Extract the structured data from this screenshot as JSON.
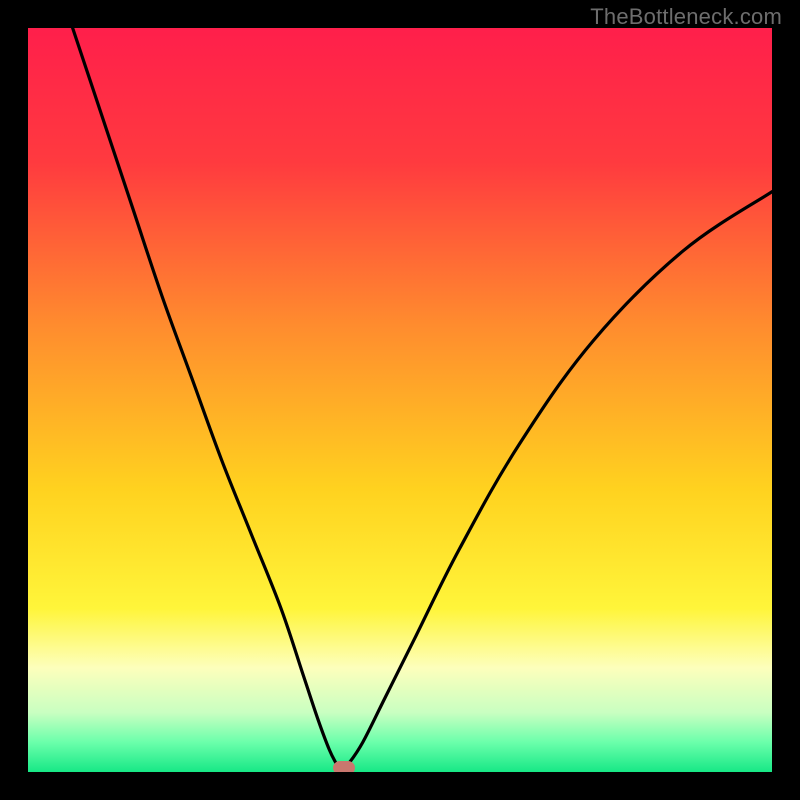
{
  "watermark": "TheBottleneck.com",
  "colors": {
    "frame": "#000000",
    "watermark_text": "#6d6d6d",
    "curve_stroke": "#000000",
    "marker": "#c9776e",
    "gradient_stops": [
      {
        "offset": "0%",
        "color": "#ff1f4b"
      },
      {
        "offset": "18%",
        "color": "#ff3a3f"
      },
      {
        "offset": "40%",
        "color": "#ff8c2e"
      },
      {
        "offset": "62%",
        "color": "#ffd21f"
      },
      {
        "offset": "78%",
        "color": "#fff53a"
      },
      {
        "offset": "86%",
        "color": "#fdffbc"
      },
      {
        "offset": "92%",
        "color": "#c9ffc1"
      },
      {
        "offset": "96%",
        "color": "#6bffab"
      },
      {
        "offset": "100%",
        "color": "#17e886"
      }
    ]
  },
  "chart_data": {
    "type": "line",
    "title": "",
    "xlabel": "",
    "ylabel": "",
    "x_range": [
      0,
      100
    ],
    "y_range": [
      0,
      100
    ],
    "vertex_x": 42,
    "marker": {
      "x": 42.5,
      "y": 0.5
    },
    "series": [
      {
        "name": "bottleneck-curve",
        "x": [
          6,
          10,
          14,
          18,
          22,
          26,
          30,
          34,
          37,
          39,
          40.5,
          41.5,
          42,
          43,
          45,
          48,
          52,
          58,
          66,
          76,
          88,
          100
        ],
        "y": [
          100,
          88,
          76,
          64,
          53,
          42,
          32,
          22,
          13,
          7,
          3,
          1,
          0,
          1,
          4,
          10,
          18,
          30,
          44,
          58,
          70,
          78
        ]
      }
    ],
    "notes": "V-shaped bottleneck curve on a red-yellow-green vertical gradient; minimum near x≈42. Red/pink pill marker at the curve vertex on the baseline."
  }
}
